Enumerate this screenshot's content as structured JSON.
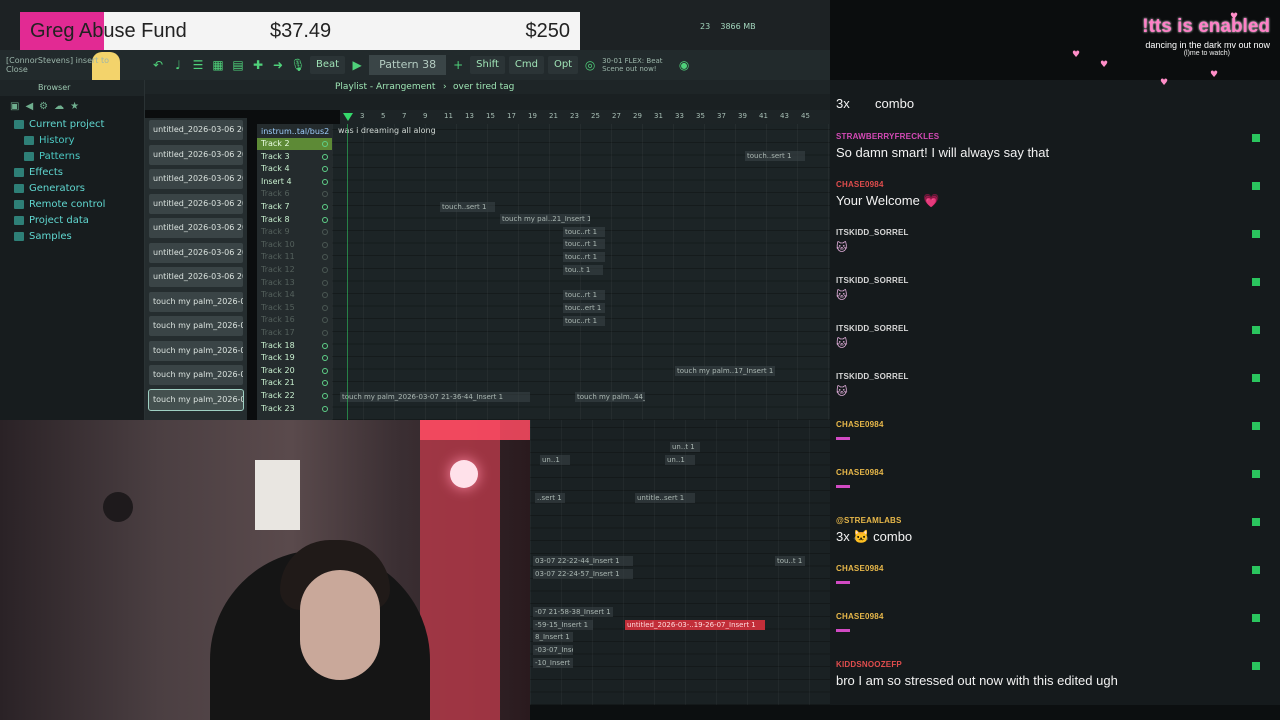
{
  "donation": {
    "name": "Greg Abuse Fund",
    "raised": "$37.49",
    "goal": "$250"
  },
  "toolbar": {
    "beat_label": "Beat",
    "pattern_label": "Pattern 38",
    "shift": "Shift",
    "cmd": "Cmd",
    "opt": "Opt",
    "news": "30-01 FLEX: Beat Scene out now!",
    "memory": "3866 MB",
    "cpu": "23",
    "close_hint": "[ConnorStevens] insert to",
    "close": "Close"
  },
  "browser": {
    "title": "Browser",
    "items": [
      {
        "label": "Current project",
        "level": "top"
      },
      {
        "label": "History",
        "level": "sub"
      },
      {
        "label": "Patterns",
        "level": "sub"
      },
      {
        "label": "Effects",
        "level": "top"
      },
      {
        "label": "Generators",
        "level": "top"
      },
      {
        "label": "Remote control",
        "level": "top"
      },
      {
        "label": "Project data",
        "level": "top"
      },
      {
        "label": "Samples",
        "level": "top"
      }
    ]
  },
  "pattern_list": [
    "untitled_2026-03-06 20-...",
    "untitled_2026-03-06 20-...",
    "untitled_2026-03-06 20-...",
    "untitled_2026-03-06 20-...",
    "untitled_2026-03-06 20-...",
    "untitled_2026-03-06 20-...",
    "untitled_2026-03-06 20-...",
    "touch my palm_2026-03...",
    "touch my palm_2026-03...",
    "touch my palm_2026-03...",
    "touch my palm_2026-03...",
    "touch my palm_2026-03..."
  ],
  "playlist": {
    "title": "Playlist - Arrangement",
    "sep": "›",
    "arrangement": "over tired tag",
    "track1_label": "instrum..tal/bus2",
    "pattern_clip": "was i dreaming all along",
    "ruler": [
      "3",
      "5",
      "7",
      "9",
      "11",
      "13",
      "15",
      "17",
      "19",
      "21",
      "23",
      "25",
      "27",
      "29",
      "31",
      "33",
      "35",
      "37",
      "39",
      "41",
      "43",
      "45"
    ],
    "tracks": [
      {
        "label": "Track 2",
        "state": "sel"
      },
      {
        "label": "Track 3",
        "state": "active"
      },
      {
        "label": "Track 4",
        "state": "active"
      },
      {
        "label": "Insert 4",
        "state": "active"
      },
      {
        "label": "Track 6",
        "state": "dim"
      },
      {
        "label": "Track 7",
        "state": "active"
      },
      {
        "label": "Track 8",
        "state": "active"
      },
      {
        "label": "Track 9",
        "state": "dim"
      },
      {
        "label": "Track 10",
        "state": "dim"
      },
      {
        "label": "Track 11",
        "state": "dim"
      },
      {
        "label": "Track 12",
        "state": "dim"
      },
      {
        "label": "Track 13",
        "state": "dim"
      },
      {
        "label": "Track 14",
        "state": "dim"
      },
      {
        "label": "Track 15",
        "state": "dim"
      },
      {
        "label": "Track 16",
        "state": "dim"
      },
      {
        "label": "Track 17",
        "state": "dim"
      },
      {
        "label": "Track 18",
        "state": "active"
      },
      {
        "label": "Track 19",
        "state": "active"
      },
      {
        "label": "Track 20",
        "state": "active"
      },
      {
        "label": "Track 21",
        "state": "active"
      },
      {
        "label": "Track 22",
        "state": "active"
      },
      {
        "label": "Track 23",
        "state": "active"
      }
    ],
    "clips": [
      {
        "text": "touch..sert 1",
        "style": "plain"
      },
      {
        "text": "touch..sert 1",
        "style": "plain"
      },
      {
        "text": "touch my pal..21_Insert 1",
        "style": "plain"
      },
      {
        "text": "touc..rt 1",
        "style": "plain"
      },
      {
        "text": "touc..rt 1",
        "style": "plain"
      },
      {
        "text": "touc..rt 1",
        "style": "plain"
      },
      {
        "text": "tou..t 1",
        "style": "plain"
      },
      {
        "text": "touc..rt 1",
        "style": "plain"
      },
      {
        "text": "touc..ert 1",
        "style": "plain"
      },
      {
        "text": "touc..rt 1",
        "style": "plain"
      },
      {
        "text": "touch my palm..17_Insert 1",
        "style": "plain"
      },
      {
        "text": "touch my palm_2026-03-07 21-36-44_Insert 1",
        "style": "plain"
      },
      {
        "text": "touch my palm..44_Insert 1",
        "style": "plain"
      },
      {
        "text": "un..1",
        "style": "plain"
      },
      {
        "text": "un..1",
        "style": "plain"
      },
      {
        "text": "un..t 1",
        "style": "plain"
      },
      {
        "text": "..sert 1",
        "style": "plain"
      },
      {
        "text": "untitle..sert 1",
        "style": "plain"
      },
      {
        "text": "03-07 22-22-44_Insert 1",
        "style": "plain"
      },
      {
        "text": "03-07 22-24-57_Insert 1",
        "style": "plain"
      },
      {
        "text": "tou..t 1",
        "style": "plain"
      },
      {
        "text": "-07 21-58-38_Insert 1",
        "style": "plain"
      },
      {
        "text": "-59-15_Insert 1",
        "style": "plain"
      },
      {
        "text": "untitled_2026-03-..19-26-07_Insert 1",
        "style": "red"
      },
      {
        "text": "8_Insert 1",
        "style": "plain"
      },
      {
        "text": "-03-07_Insert 1",
        "style": "plain"
      },
      {
        "text": "-10_Insert 1",
        "style": "plain"
      }
    ]
  },
  "chat": {
    "combo_top": "combo",
    "combo_top_count": "3x",
    "messages": [
      {
        "user": "STRAWBERRYFRECKLES",
        "color": "#d44ab6",
        "text": "So damn smart! I will always say that"
      },
      {
        "user": "CHASE0984",
        "color": "#e04d4d",
        "text": "Your Welcome 💗"
      },
      {
        "user": "ITSKIDD_SORREL",
        "color": "#d7d7d7",
        "text": "🐱"
      },
      {
        "user": "ITSKIDD_SORREL",
        "color": "#d7d7d7",
        "text": "🐱"
      },
      {
        "user": "ITSKIDD_SORREL",
        "color": "#d7d7d7",
        "text": "🐱"
      },
      {
        "user": "ITSKIDD_SORREL",
        "color": "#d7d7d7",
        "text": "🐱"
      },
      {
        "user": "CHASE0984",
        "color": "#e8b84a",
        "text": ""
      },
      {
        "user": "CHASE0984",
        "color": "#e8b84a",
        "text": ""
      },
      {
        "user": "@STREAMLABS",
        "color": "#e8b84a",
        "text": "3x 🐱 combo"
      },
      {
        "user": "CHASE0984",
        "color": "#e8b84a",
        "text": ""
      },
      {
        "user": "CHASE0984",
        "color": "#e8b84a",
        "text": ""
      },
      {
        "user": "KIDDSNOOZEFP",
        "color": "#e04d4d",
        "text": "bro I am so stressed out now with this edited ugh"
      }
    ]
  },
  "tts": {
    "title": "!tts is enabled",
    "song": "dancing in the dark mv out now",
    "hint": "(l)me to watch)"
  },
  "colors": {
    "fl_green": "#4fd17a",
    "donation_pink": "#e22a93",
    "chat_badge": "#2ac55e"
  }
}
